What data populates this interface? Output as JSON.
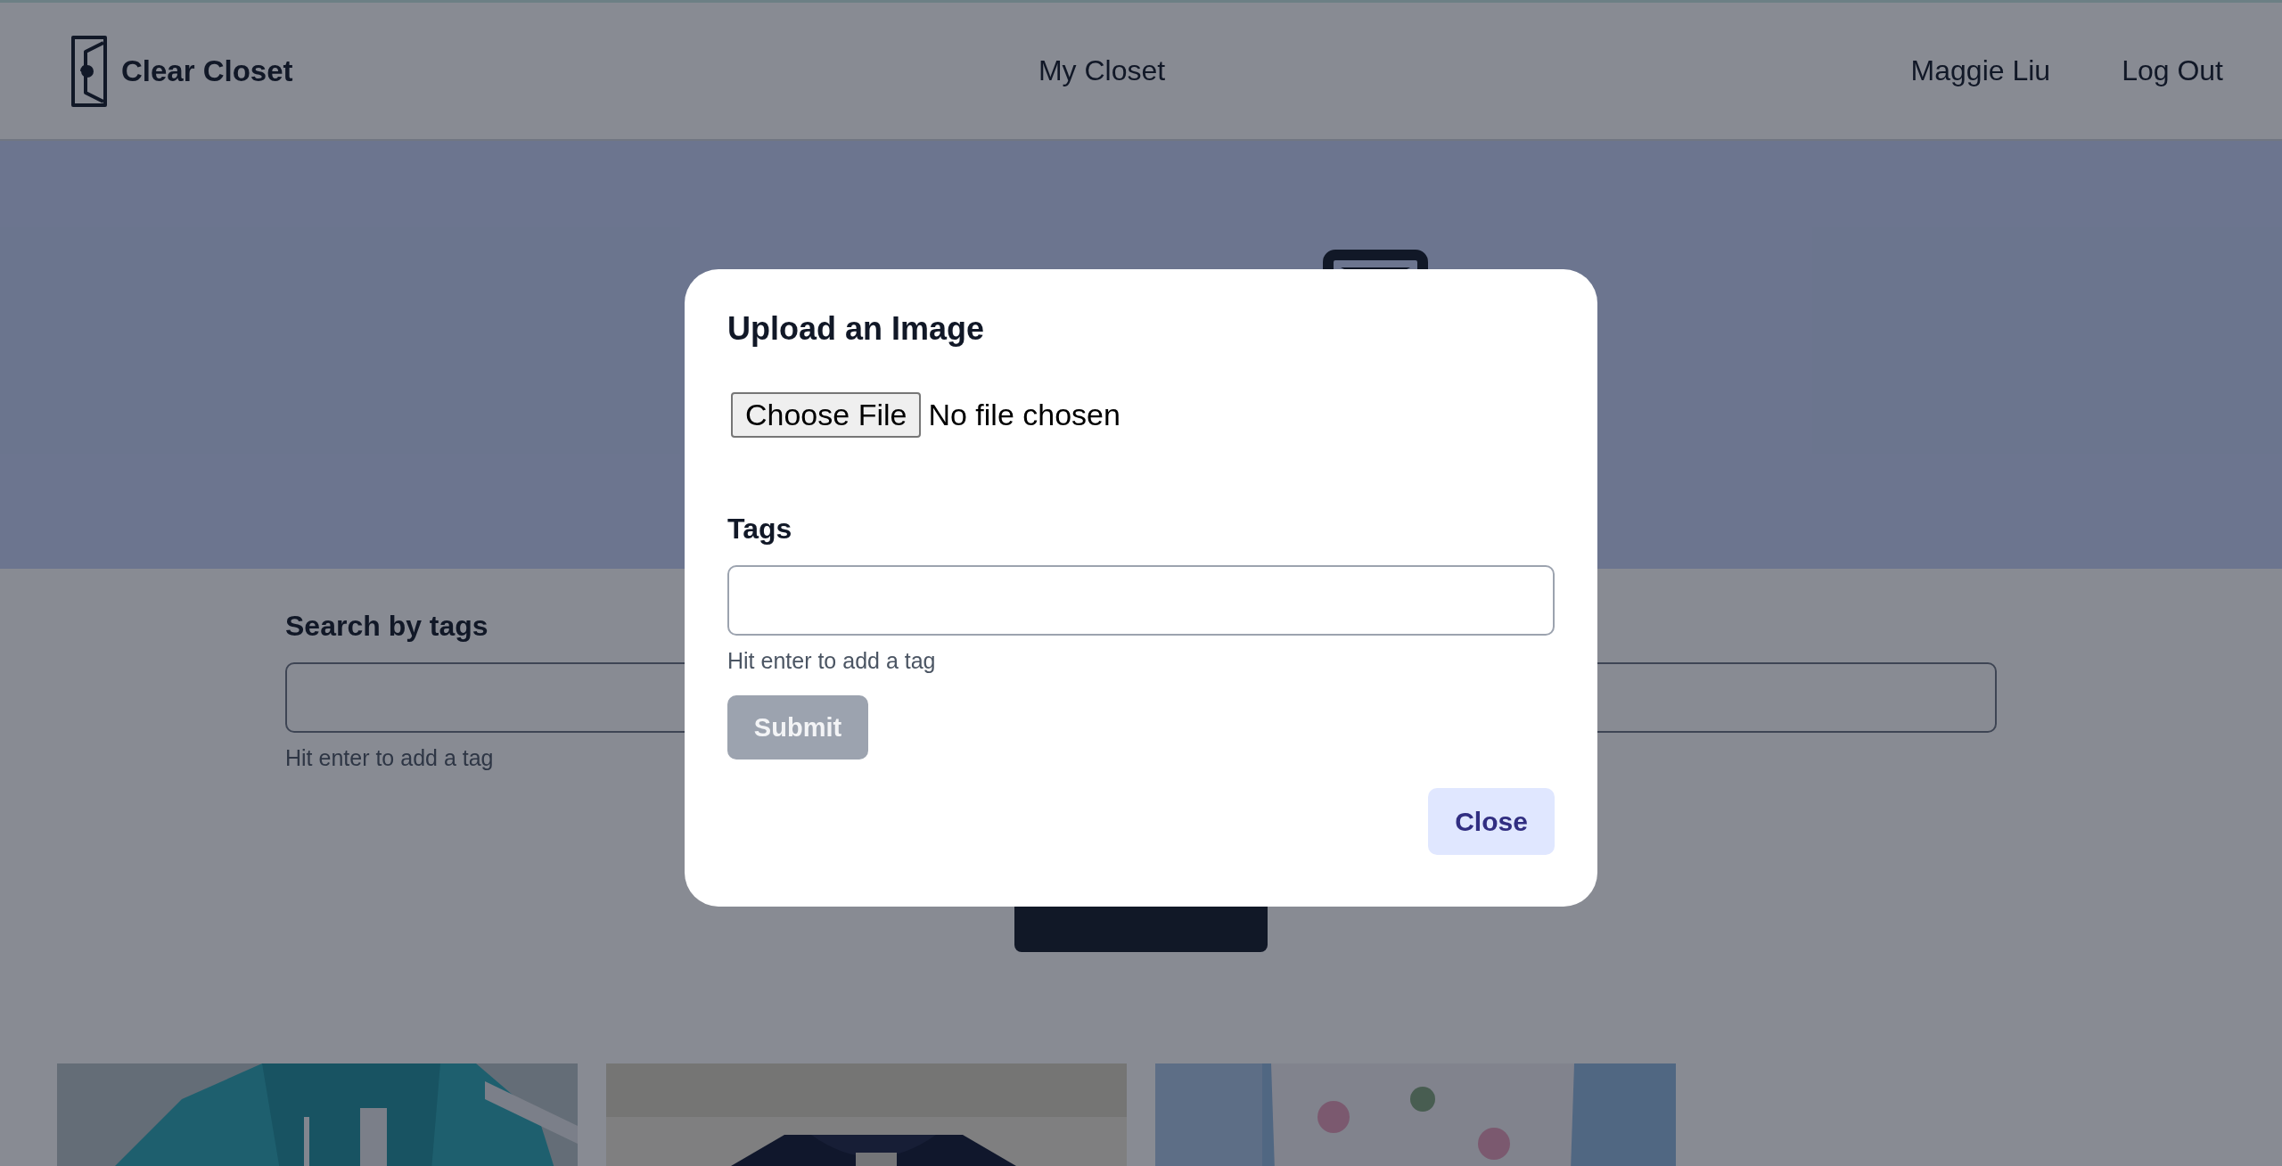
{
  "header": {
    "brand": "Clear Closet",
    "nav": [
      {
        "label": "My Closet"
      }
    ],
    "user": "Maggie Liu",
    "logout": "Log Out"
  },
  "search": {
    "label": "Search by tags",
    "hint": "Hit enter to add a tag"
  },
  "modal": {
    "title": "Upload an Image",
    "file_button": "Choose File",
    "file_status": "No file chosen",
    "tags_label": "Tags",
    "tags_hint": "Hit enter to add a tag",
    "submit": {
      "label": "Submit",
      "disabled": true
    },
    "close": "Close"
  }
}
